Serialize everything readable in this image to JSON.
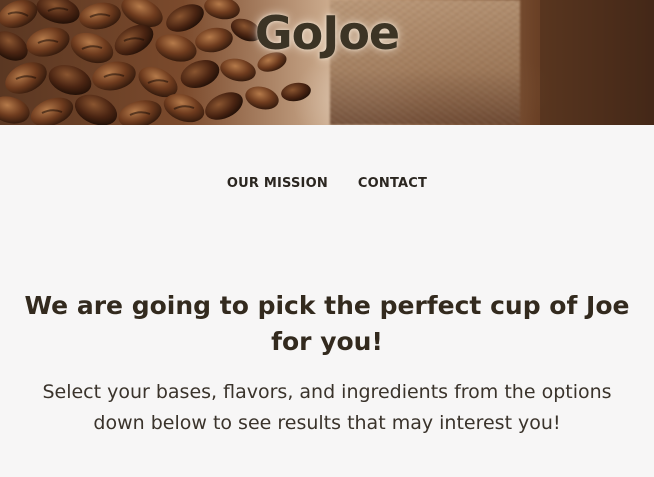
{
  "header": {
    "brand": "GoJoe",
    "background_image": "coffee-beans-burlap-sack"
  },
  "nav": {
    "items": [
      {
        "label": "OUR MISSION"
      },
      {
        "label": "CONTACT"
      }
    ]
  },
  "main": {
    "heading": "We are going to pick the perfect cup of Joe for you!",
    "description": "Select your bases, flavors, and ingredients from the options down below to see results that may interest you!"
  },
  "colors": {
    "page_background": "#f7f6f6",
    "brand_text": "#3c3425",
    "heading_text": "#332a1e",
    "nav_text": "#2b2620"
  }
}
